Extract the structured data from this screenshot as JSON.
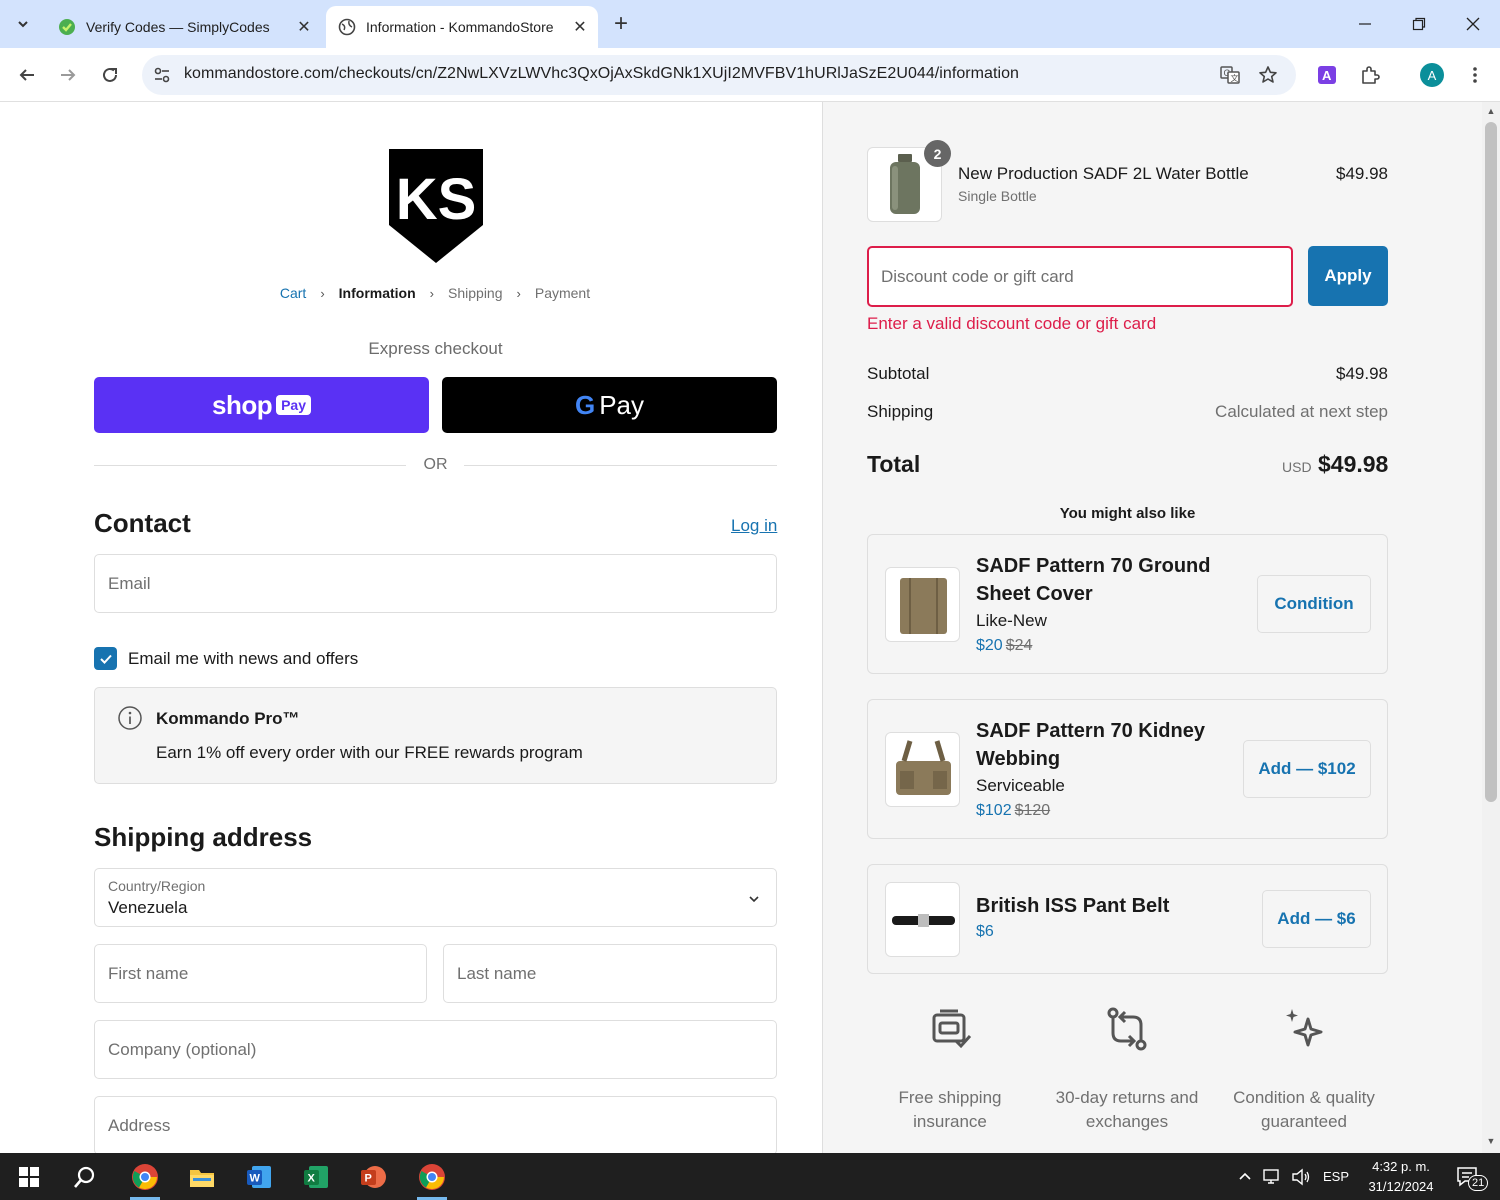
{
  "browser": {
    "tabs": [
      {
        "title": "Verify Codes — SimplyCodes",
        "icon": "simplycodes-icon",
        "active": false
      },
      {
        "title": "Information - KommandoStore",
        "icon": "globe-icon",
        "active": true
      }
    ],
    "url": "kommandostore.com/checkouts/cn/Z2NwLXVzLWVhc3QxOjAxSkdGNk1XUjI2MVFBV1hURlJaSzE2U044/information",
    "profile_initial": "A"
  },
  "checkout": {
    "logo_text": "KS",
    "breadcrumbs": [
      "Cart",
      "Information",
      "Shipping",
      "Payment"
    ],
    "express_checkout_label": "Express checkout",
    "shoppay": {
      "word": "shop",
      "badge": "Pay"
    },
    "gpay": {
      "g": "G",
      "word": "Pay"
    },
    "or_label": "OR",
    "contact": {
      "heading": "Contact",
      "login_label": "Log in",
      "email_placeholder": "Email",
      "news_checkbox_label": "Email me with news and offers",
      "news_checked": true
    },
    "pro_box": {
      "title": "Kommando Pro™",
      "text": "Earn 1% off every order with our FREE rewards program"
    },
    "shipping": {
      "heading": "Shipping address",
      "country_label": "Country/Region",
      "country_value": "Venezuela",
      "first_name_placeholder": "First name",
      "last_name_placeholder": "Last name",
      "company_placeholder": "Company (optional)",
      "address_placeholder": "Address"
    }
  },
  "summary": {
    "item": {
      "quantity": "2",
      "name": "New Production SADF 2L Water Bottle",
      "variant": "Single Bottle",
      "price": "$49.98"
    },
    "discount": {
      "placeholder": "Discount code or gift card",
      "apply_label": "Apply",
      "error": "Enter a valid discount code or gift card"
    },
    "subtotal_label": "Subtotal",
    "subtotal_value": "$49.98",
    "shipping_label": "Shipping",
    "shipping_value": "Calculated at next step",
    "total_label": "Total",
    "total_currency": "USD",
    "total_value": "$49.98",
    "upsell_title": "You might also like",
    "upsells": [
      {
        "name": "SADF Pattern 70 Ground Sheet Cover",
        "condition": "Like-New",
        "price": "$20",
        "old_price": "$24",
        "button": "Condition"
      },
      {
        "name": "SADF Pattern 70 Kidney Webbing",
        "condition": "Serviceable",
        "price": "$102",
        "old_price": "$120",
        "button": "Add — $102"
      },
      {
        "name": "British ISS Pant Belt",
        "condition": "",
        "price": "$6",
        "old_price": "",
        "button": "Add — $6"
      }
    ],
    "features": [
      {
        "icon": "shipping-insurance-icon",
        "text": "Free shipping insurance"
      },
      {
        "icon": "returns-exchange-icon",
        "text": "30-day returns and exchanges"
      },
      {
        "icon": "sparkle-quality-icon",
        "text": "Condition & quality guaranteed"
      }
    ]
  },
  "taskbar": {
    "language": "ESP",
    "time": "4:32 p. m.",
    "date": "31/12/2024",
    "notification_count": "21"
  },
  "colors": {
    "accent": "#1773b0",
    "error": "#dd1d4a",
    "shoppay": "#5a31f4",
    "chrome_tabbar": "#d3e3fd"
  }
}
